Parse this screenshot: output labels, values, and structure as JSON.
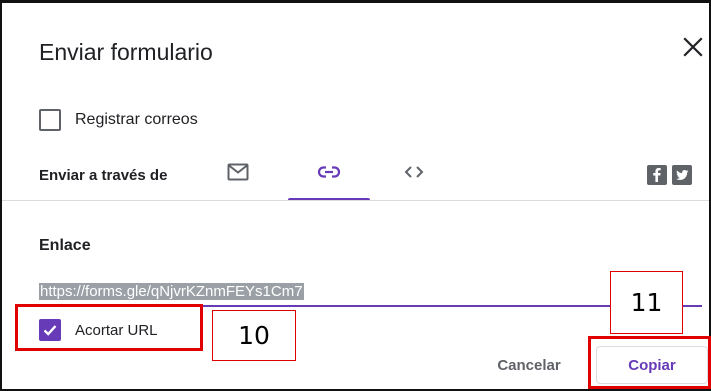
{
  "dialog": {
    "title": "Enviar formulario",
    "close_icon": "close-icon"
  },
  "collect_emails": {
    "label": "Registrar correos",
    "checked": false
  },
  "send_via": {
    "label": "Enviar a través de",
    "tabs": [
      {
        "name": "email",
        "icon": "mail-icon",
        "selected": false
      },
      {
        "name": "link",
        "icon": "link-icon",
        "selected": true
      },
      {
        "name": "embed",
        "icon": "code-brackets-icon",
        "selected": false
      }
    ],
    "social": [
      "facebook-icon",
      "twitter-icon"
    ]
  },
  "link_section": {
    "label": "Enlace",
    "url": "https://forms.gle/qNjvrKZnmFEYs1Cm7",
    "shorten_label": "Acortar URL",
    "shorten_checked": true
  },
  "actions": {
    "cancel_label": "Cancelar",
    "copy_label": "Copiar"
  },
  "annotations": {
    "label_10": "10",
    "label_11": "11"
  },
  "colors": {
    "accent": "#673ab7",
    "annotation": "#e00000",
    "text": "#202124",
    "secondary": "#5f6368",
    "selection": "#9aa0a6"
  }
}
